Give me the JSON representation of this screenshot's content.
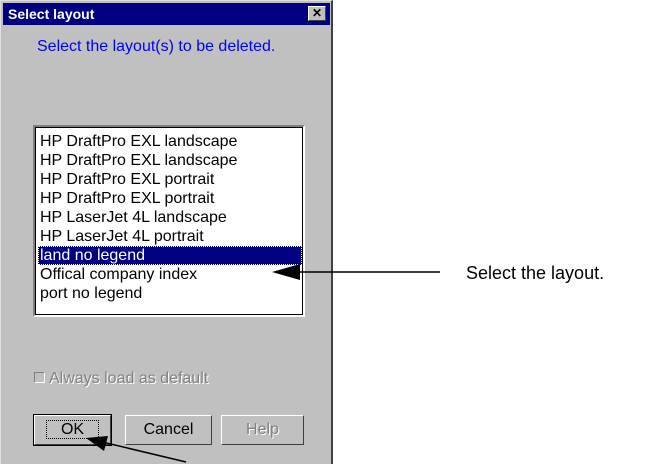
{
  "dialog": {
    "title": "Select layout",
    "close_glyph": "✕",
    "instruction": "Select the layout(s) to be deleted.",
    "layouts": [
      {
        "label": "HP DraftPro EXL landscape",
        "selected": false
      },
      {
        "label": "HP DraftPro EXL landscape",
        "selected": false
      },
      {
        "label": "HP DraftPro EXL portrait",
        "selected": false
      },
      {
        "label": "HP DraftPro EXL portrait",
        "selected": false
      },
      {
        "label": "HP LaserJet 4L landscape",
        "selected": false
      },
      {
        "label": "HP LaserJet 4L portrait",
        "selected": false
      },
      {
        "label": "land no legend",
        "selected": true
      },
      {
        "label": "Offical company index",
        "selected": false
      },
      {
        "label": "port no legend",
        "selected": false
      }
    ],
    "checkbox_label": "Always load as default",
    "checkbox_checked": false,
    "checkbox_enabled": false,
    "buttons": {
      "ok": "OK",
      "cancel": "Cancel",
      "help": "Help"
    }
  },
  "annotation": {
    "select_text": "Select the layout."
  },
  "colors": {
    "titlebar": "#000080",
    "dialog_bg": "#c0c0c0",
    "instruction": "#0000ff",
    "selection": "#000080"
  }
}
